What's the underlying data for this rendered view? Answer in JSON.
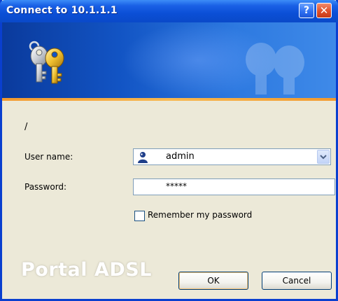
{
  "window": {
    "title": "Connect to 10.1.1.1",
    "help_label": "?",
    "close_label": "✕"
  },
  "dialog": {
    "realm": "/",
    "username_label": "User name:",
    "username_value": "admin",
    "password_label": "Password:",
    "password_value": "*****",
    "remember_label": "Remember my password",
    "remember_checked": false,
    "watermark": "Portal ADSL",
    "ok_label": "OK",
    "cancel_label": "Cancel"
  },
  "colors": {
    "title_bar": "#0b4fd6",
    "banner_accent": "#f39a2e",
    "dialog_bg": "#ece9d8"
  },
  "icons": {
    "banner": "keys-icon",
    "user": "user-icon",
    "dropdown": "chevron-down-icon"
  }
}
